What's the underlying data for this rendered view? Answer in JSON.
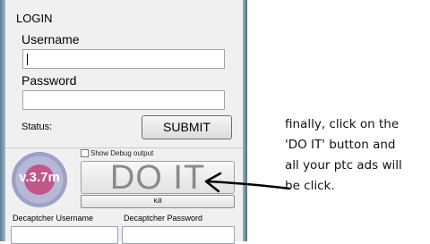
{
  "login": {
    "title": "LOGIN",
    "username_label": "Username",
    "username_value": "",
    "password_label": "Password",
    "password_value": "",
    "status_label": "Status:",
    "submit_label": "SUBMIT"
  },
  "logo": {
    "text": "v.3.7m"
  },
  "debug": {
    "label": "Show Debug output",
    "checked": false
  },
  "actions": {
    "doit_label": "DO IT",
    "kill_label": "Kill"
  },
  "decaptcher": {
    "username_label": "Decaptcher Username",
    "username_value": "",
    "password_label": "Decaptcher Password",
    "password_value": ""
  },
  "annotation": {
    "lines": [
      "finally, click on the",
      "'DO IT' button and",
      "all your ptc ads will",
      "be click."
    ]
  }
}
